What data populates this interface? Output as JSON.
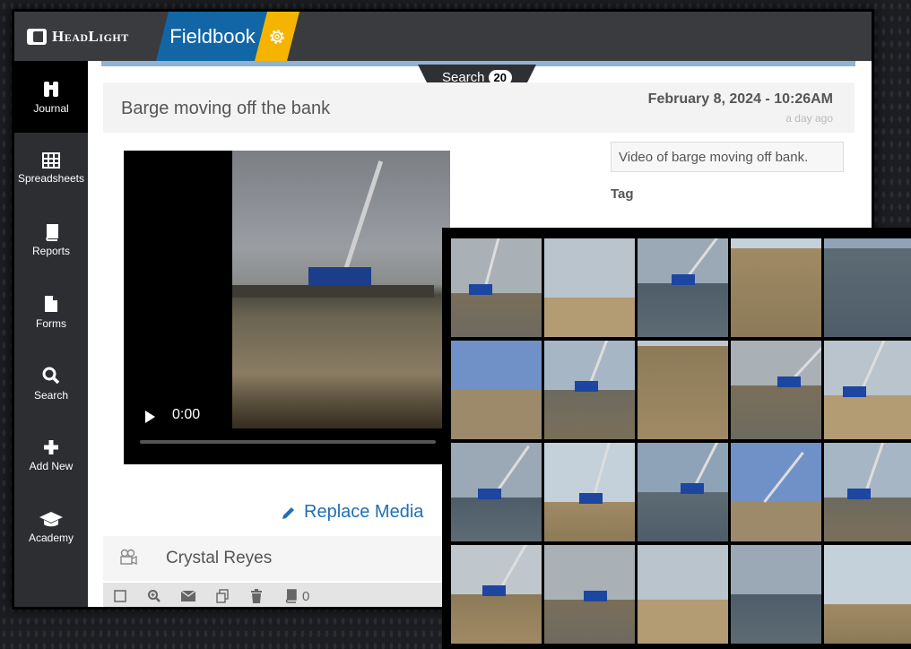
{
  "app": {
    "brand": "HeadLight",
    "module": "Fieldbook"
  },
  "sidebar": {
    "items": [
      {
        "label": "Journal",
        "icon": "binoculars-icon",
        "active": true
      },
      {
        "label": "Spreadsheets",
        "icon": "grid-icon"
      },
      {
        "label": "Reports",
        "icon": "book-icon"
      },
      {
        "label": "Forms",
        "icon": "forms-icon"
      },
      {
        "label": "Search",
        "icon": "search-icon"
      },
      {
        "label": "Add New",
        "icon": "plus-icon"
      },
      {
        "label": "Academy",
        "icon": "graduation-cap-icon"
      }
    ]
  },
  "search": {
    "label": "Search",
    "count": "20"
  },
  "entry": {
    "title": "Barge moving off the bank",
    "date": "February 8, 2024 - 10:26AM",
    "relative": "a day ago",
    "description": "Video of barge moving off bank.",
    "tag_label": "Tag",
    "video_time": "0:00",
    "replace_media": "Replace Media",
    "author": "Crystal Reyes",
    "notebook_count": "0"
  },
  "colors": {
    "accent_blue": "#1266a6",
    "gear_yellow": "#f5b400",
    "link_blue": "#1f6fb4"
  }
}
